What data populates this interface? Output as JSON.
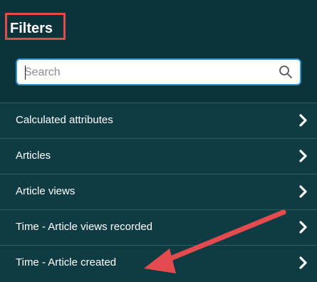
{
  "panel": {
    "title": "Filters"
  },
  "search": {
    "placeholder": "Search",
    "value": ""
  },
  "items": [
    {
      "label": "Calculated attributes"
    },
    {
      "label": "Articles"
    },
    {
      "label": "Article views"
    },
    {
      "label": "Time - Article views recorded"
    },
    {
      "label": "Time - Article created"
    }
  ],
  "icons": {
    "search": "search-icon",
    "chevron": "chevron-right-icon"
  },
  "colors": {
    "panel_bg": "#0e3a40",
    "header_bg": "#0b333a",
    "highlight": "#e34b4f",
    "search_border": "#2b8fd6"
  }
}
